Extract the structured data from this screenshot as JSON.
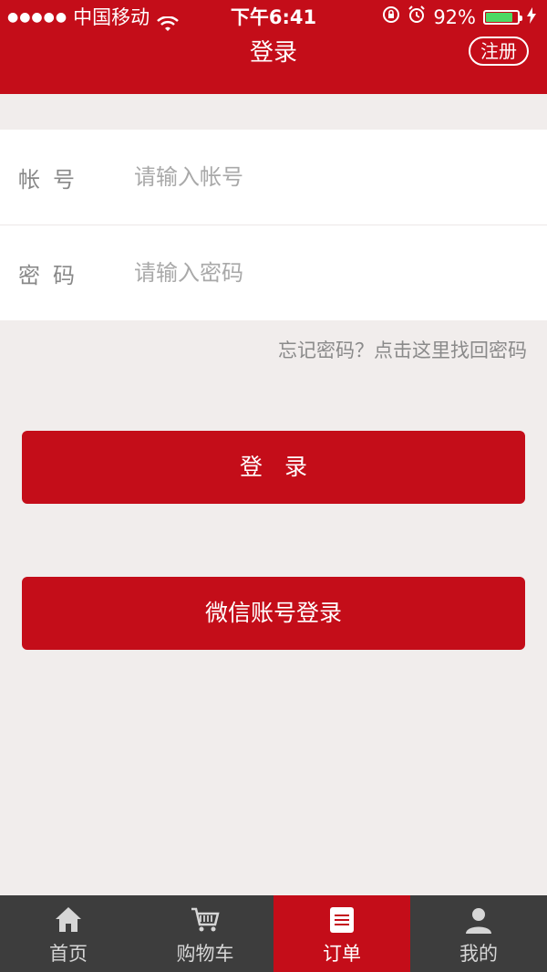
{
  "status_bar": {
    "signal_dots": "●●●●●",
    "carrier": "中国移动",
    "time": "下午6:41",
    "battery_percent": "92%",
    "battery_level": 0.92
  },
  "nav": {
    "title": "登录",
    "register_label": "注册"
  },
  "form": {
    "account_label": "帐号",
    "account_placeholder": "请输入帐号",
    "password_label": "密码",
    "password_placeholder": "请输入密码"
  },
  "forgot_link": "忘记密码？点击这里找回密码",
  "buttons": {
    "login": "登录",
    "wechat_login": "微信账号登录"
  },
  "tabs": [
    {
      "label": "首页",
      "icon": "home-icon"
    },
    {
      "label": "购物车",
      "icon": "cart-icon"
    },
    {
      "label": "订单",
      "icon": "order-icon"
    },
    {
      "label": "我的",
      "icon": "user-icon"
    }
  ],
  "colors": {
    "brand": "#c40d19",
    "tabbar": "#3d3d3d",
    "background": "#f1edec"
  }
}
